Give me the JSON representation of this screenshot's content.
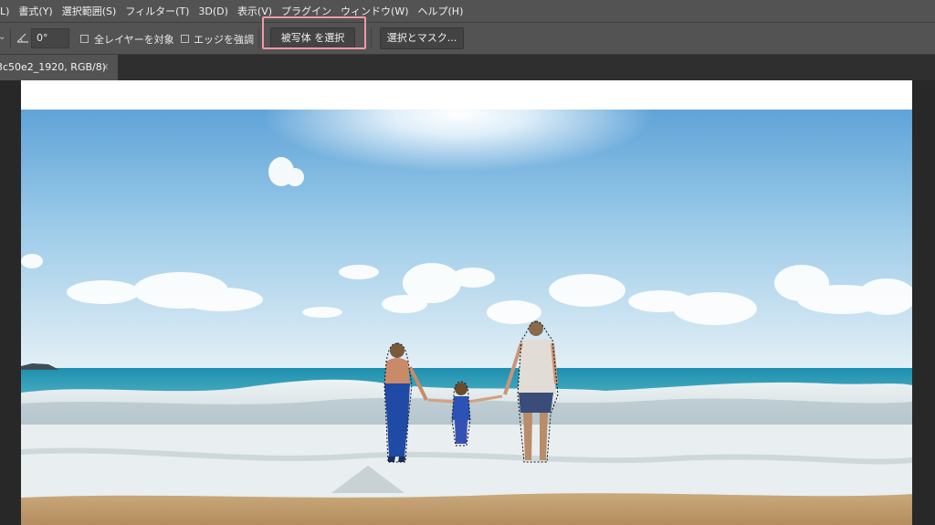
{
  "menubar": {
    "items": [
      "L)",
      "書式(Y)",
      "選択範囲(S)",
      "フィルター(T)",
      "3D(D)",
      "表示(V)",
      "プラグイン",
      "ウィンドウ(W)",
      "ヘルプ(H)"
    ]
  },
  "options": {
    "angle_value": "0°",
    "sample_all_layers_label": "全レイヤーを対象",
    "enhance_edge_label": "エッジを強調",
    "select_subject_label": "被写体 を選択",
    "select_and_mask_label": "選択とマスク..."
  },
  "document": {
    "tab_title": "3c50e2_1920, RGB/8)",
    "close_glyph": "×"
  },
  "colors": {
    "panel": "#535353",
    "workspace": "#282828",
    "highlight": "#f09aa3"
  }
}
